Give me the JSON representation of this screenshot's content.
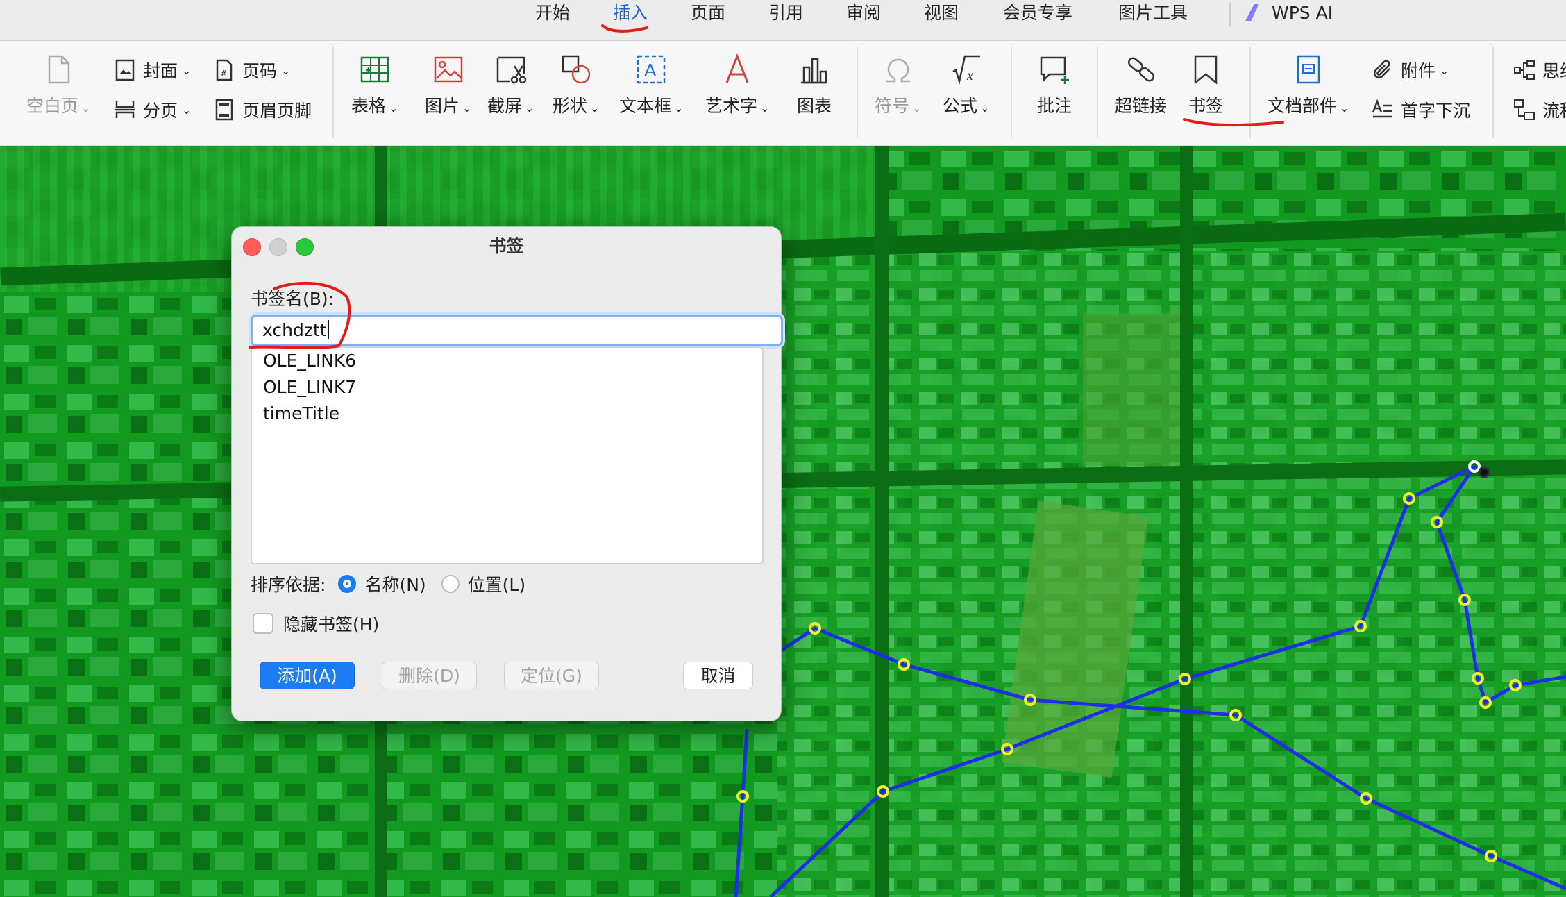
{
  "menubar": {
    "tabs": [
      "开始",
      "插入",
      "页面",
      "引用",
      "审阅",
      "视图",
      "会员专享",
      "图片工具"
    ],
    "active_tab": "插入",
    "ai_label": "WPS AI"
  },
  "ribbon": {
    "blank_page": "空白页",
    "cover": "封面",
    "page_number": "页码",
    "page_break": "分页",
    "header_footer": "页眉页脚",
    "table": "表格",
    "picture": "图片",
    "screenshot": "截屏",
    "shape": "形状",
    "textbox": "文本框",
    "wordart": "艺术字",
    "chart": "图表",
    "symbol": "符号",
    "formula": "公式",
    "comment": "批注",
    "hyperlink": "超链接",
    "bookmark": "书签",
    "doc_parts": "文档部件",
    "attachment": "附件",
    "drop_cap": "首字下沉",
    "mindmap": "思维",
    "flowchart": "流程"
  },
  "dialog": {
    "title": "书签",
    "name_label": "书签名(B):",
    "name_value": "xchdztt",
    "bookmarks": [
      "OLE_LINK6",
      "OLE_LINK7",
      "timeTitle"
    ],
    "sort_label": "排序依据:",
    "sort_by_name": "名称(N)",
    "sort_by_position": "位置(L)",
    "sort_selected": "名称(N)",
    "hide_label": "隐藏书签(H)",
    "hide_checked": false,
    "add_button": "添加(A)",
    "delete_button": "删除(D)",
    "locate_button": "定位(G)",
    "cancel_button": "取消"
  },
  "colors": {
    "accent": "#1c7cf4",
    "map_green": "#0f8a1a",
    "route_line": "#1e2fe6",
    "route_point": "#f2f22a",
    "annotation": "#e31b1b"
  }
}
